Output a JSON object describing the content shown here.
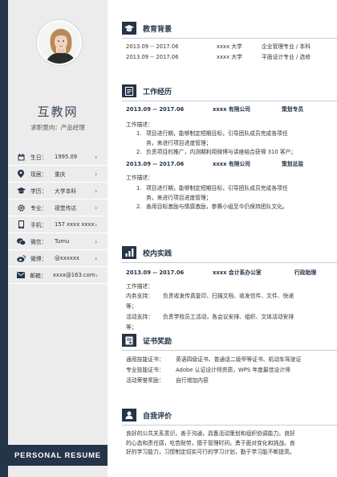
{
  "sidebar": {
    "name": "互教网",
    "intent": "求职意向：产品经理",
    "info": [
      {
        "icon": "calendar-icon",
        "label": "生日：",
        "value": "1995.09"
      },
      {
        "icon": "location-icon",
        "label": "现居：",
        "value": "重庆"
      },
      {
        "icon": "graduation-cap-icon",
        "label": "学历：",
        "value": "大学本科"
      },
      {
        "icon": "gear-icon",
        "label": "专业：",
        "value": "视觉传达"
      },
      {
        "icon": "phone-icon",
        "label": "手机：",
        "value": "157 xxxx xxxx"
      },
      {
        "icon": "wechat-icon",
        "label": "微信：",
        "value": "Tumu"
      },
      {
        "icon": "weibo-icon",
        "label": "微博：",
        "value": "@xxxxxx"
      },
      {
        "icon": "mail-icon",
        "label": "邮箱：",
        "value": "xxxx@163.com"
      }
    ],
    "banner": "PERSONAL RESUME"
  },
  "education": {
    "title": "教育背景",
    "rows": [
      {
        "period": "2013.09 -- 2017.06",
        "school": "xxxx 大学",
        "major": "企业管理专业 / 本科"
      },
      {
        "period": "2013.09 -- 2017.06",
        "school": "xxxx 大学",
        "major": "平面设计专业 / 选修"
      }
    ]
  },
  "work": {
    "title": "工作经历",
    "jobs": [
      {
        "period": "2013.09 -- 2017.06",
        "company": "xxxx 有限公司",
        "role": "策划专员",
        "desc_label": "工作描述：",
        "bullets": [
          [
            "1.",
            "项目进行期，能够制定短期目标，引导团队成员完成各项任",
            "务，来进行项目进度管理；"
          ],
          [
            "2.",
            "负责项目的推广，内测期利用微博与讲座结合获得 310 客户；"
          ]
        ]
      },
      {
        "period": "2013.09 -- 2017.06",
        "company": "xxxx 有限公司",
        "role": "策划总监",
        "desc_label": "工作描述：",
        "bullets": [
          [
            "1.",
            "项目进行期，能够制定短期目标，引导团队成员完成各项任",
            "务，来进行项目进度管理；"
          ],
          [
            "2.",
            "善用目标激励与情感激励，参赛小组至今仍保持团队文化。"
          ]
        ]
      }
    ]
  },
  "campus": {
    "title": "校内实践",
    "period": "2013.09 -- 2017.06",
    "org": "xxxx 会计系办公室",
    "role": "行政助理",
    "desc_label": "工作描述：",
    "lines": [
      {
        "label": "内务支持：",
        "text": "负责收发传真复印、扫描文档、收发信件、文件、快递",
        "cont": "等；"
      },
      {
        "label": "活动支持：",
        "text": "负责学校员工活动，各会议安排、组织、文体活动安排",
        "cont": "等；"
      }
    ]
  },
  "certs": {
    "title": "证书奖励",
    "rows": [
      {
        "label": "通用技能证书：",
        "text": "英语四级证书、普通话二级甲等证书、机动车驾驶证"
      },
      {
        "label": "专业技能证书：",
        "text": "Adobe 认证设计师资质，WPS 年度最佳设计师"
      },
      {
        "label": "活动荣誉奖励：",
        "text": "自行增加内容"
      }
    ]
  },
  "self": {
    "title": "自我评价",
    "lines": [
      "良好的公共关系意识，善于沟通，具备活动策划和组织协调能力。良好",
      "的心态和责任感，吃苦耐劳，擅于管理时间，勇于面对变化和挑战。良",
      "好的学习能力，习惯制定切实可行的学习计划，勤于学习能不断提高。"
    ]
  }
}
